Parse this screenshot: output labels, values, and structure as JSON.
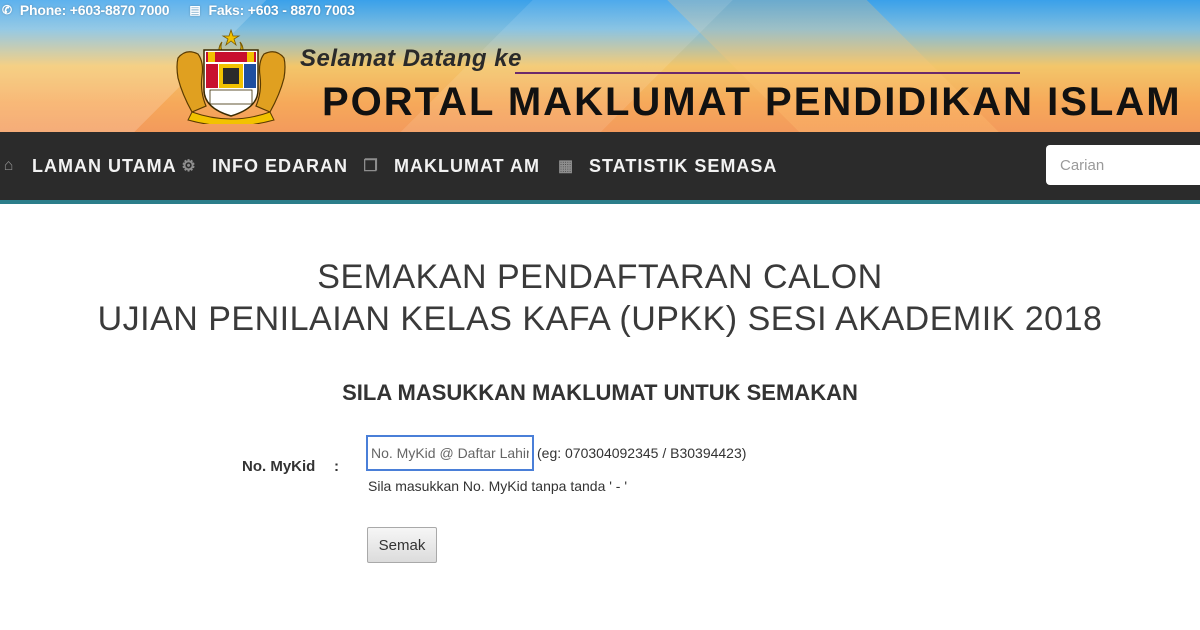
{
  "topbar": {
    "phone_icon": "phone-icon",
    "phone": "Phone: +603-8870 7000",
    "fax_icon": "fax-icon",
    "fax": "Faks: +603 - 8870 7003"
  },
  "header": {
    "logo": "jata-negara-crest",
    "welcome": "Selamat Datang ke",
    "portal_title": "PORTAL MAKLUMAT PENDIDIKAN ISLAM"
  },
  "nav": {
    "items": [
      {
        "label": "LAMAN UTAMA",
        "icon": "home-icon"
      },
      {
        "label": "INFO EDARAN",
        "icon": "gears-icon"
      },
      {
        "label": "MAKLUMAT AM",
        "icon": "documents-icon"
      },
      {
        "label": "STATISTIK SEMASA",
        "icon": "grid-icon"
      }
    ],
    "search_placeholder": "Carian"
  },
  "main": {
    "title_line1": "SEMAKAN PENDAFTARAN CALON",
    "title_line2": "UJIAN PENILAIAN KELAS KAFA (UPKK) SESI AKADEMIK 2018",
    "subtitle": "SILA MASUKKAN MAKLUMAT UNTUK SEMAKAN",
    "form": {
      "label": "No. MyKid",
      "colon": ":",
      "input_placeholder": "No. MyKid @ Daftar Lahir",
      "input_value": "",
      "example": "(eg: 070304092345 / B30394423)",
      "hint": "Sila masukkan No. MyKid tanpa tanda ' - '",
      "submit_label": "Semak"
    }
  },
  "colors": {
    "nav_bg": "#2b2b2b",
    "nav_border": "#2b7e8a",
    "input_border": "#4a7fd8"
  }
}
